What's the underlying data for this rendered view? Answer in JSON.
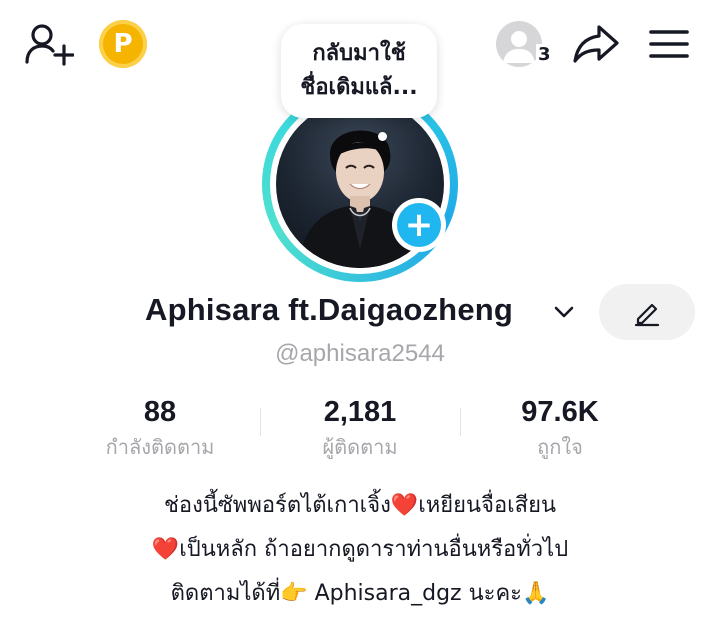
{
  "header": {
    "add_friend_icon": "person-plus-icon",
    "coin_label": "P",
    "coin_color": "#f5b400",
    "friends_count": "3",
    "share_icon": "share-arrow-icon",
    "menu_icon": "hamburger-menu-icon"
  },
  "avatar": {
    "note_bubble": "กลับมาใช้ชื่อเดิมแล้...",
    "note_line1": "กลับมาใช้",
    "note_line2": "ชื่อเดิมแล้...",
    "ring_color": "#2fd3e3",
    "add_badge_symbol": "+",
    "add_badge_color": "#20b6f0"
  },
  "profile": {
    "display_name": "Aphisara ft.Daigaozheng",
    "username": "@aphisara2544"
  },
  "stats": [
    {
      "value": "88",
      "label": "กำลังติดตาม"
    },
    {
      "value": "2,181",
      "label": "ผู้ติดตาม"
    },
    {
      "value": "97.6K",
      "label": "ถูกใจ"
    }
  ],
  "bio": {
    "line1": "ช่องนี้ซัพพอร์ตไต้เกาเจิ้ง❤️เหยียนจื่อเสียน",
    "line2": "❤️เป็นหลัก ถ้าอยากดูดาราท่านอื่นหรือทั่วไป",
    "line3": "ติดตามได้ที่👉 Aphisara_dgz นะคะ🙏"
  },
  "colors": {
    "text_primary": "#161823",
    "text_secondary": "#a6a7ab",
    "edit_button_bg": "#f1f1f2"
  }
}
